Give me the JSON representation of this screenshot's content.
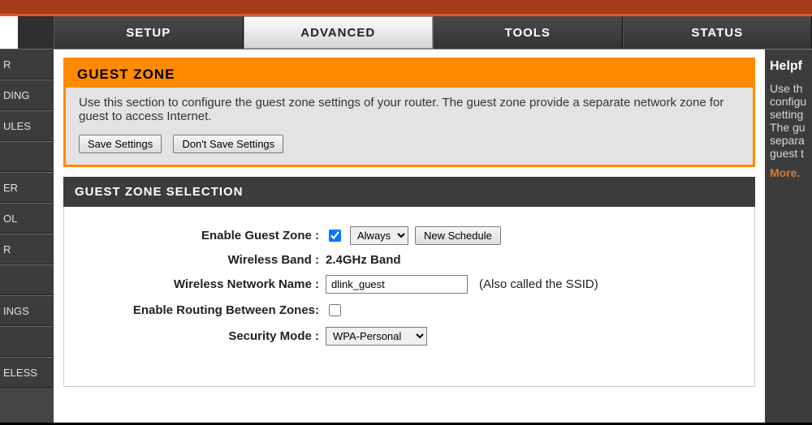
{
  "tabs": [
    "SETUP",
    "ADVANCED",
    "TOOLS",
    "STATUS"
  ],
  "active_tab": "ADVANCED",
  "sidebar": [
    "R",
    "DING",
    "ULES",
    "",
    "ER",
    "OL",
    "R",
    "",
    "INGS",
    "",
    "ELESS"
  ],
  "guest_zone": {
    "title": "GUEST ZONE",
    "desc": "Use this section to configure the guest zone settings of your router. The guest zone provide a separate network zone for guest to access Internet.",
    "save": "Save Settings",
    "dont_save": "Don't Save Settings"
  },
  "selection": {
    "title": "GUEST ZONE SELECTION",
    "enable_label": "Enable Guest Zone :",
    "enable_checked": true,
    "schedule_value": "Always",
    "new_schedule": "New Schedule",
    "band_label": "Wireless Band :",
    "band_value": "2.4GHz Band",
    "ssid_label": "Wireless Network Name :",
    "ssid_value": "dlink_guest",
    "ssid_hint": "(Also called the SSID)",
    "routing_label": "Enable Routing Between Zones:",
    "routing_checked": false,
    "security_label": "Security Mode :",
    "security_value": "WPA-Personal"
  },
  "help": {
    "title": "Helpf",
    "l1": "Use th",
    "l2": "configu",
    "l3": "setting",
    "l4": "The gu",
    "l5": "separa",
    "l6": "guest t",
    "more": "More."
  }
}
